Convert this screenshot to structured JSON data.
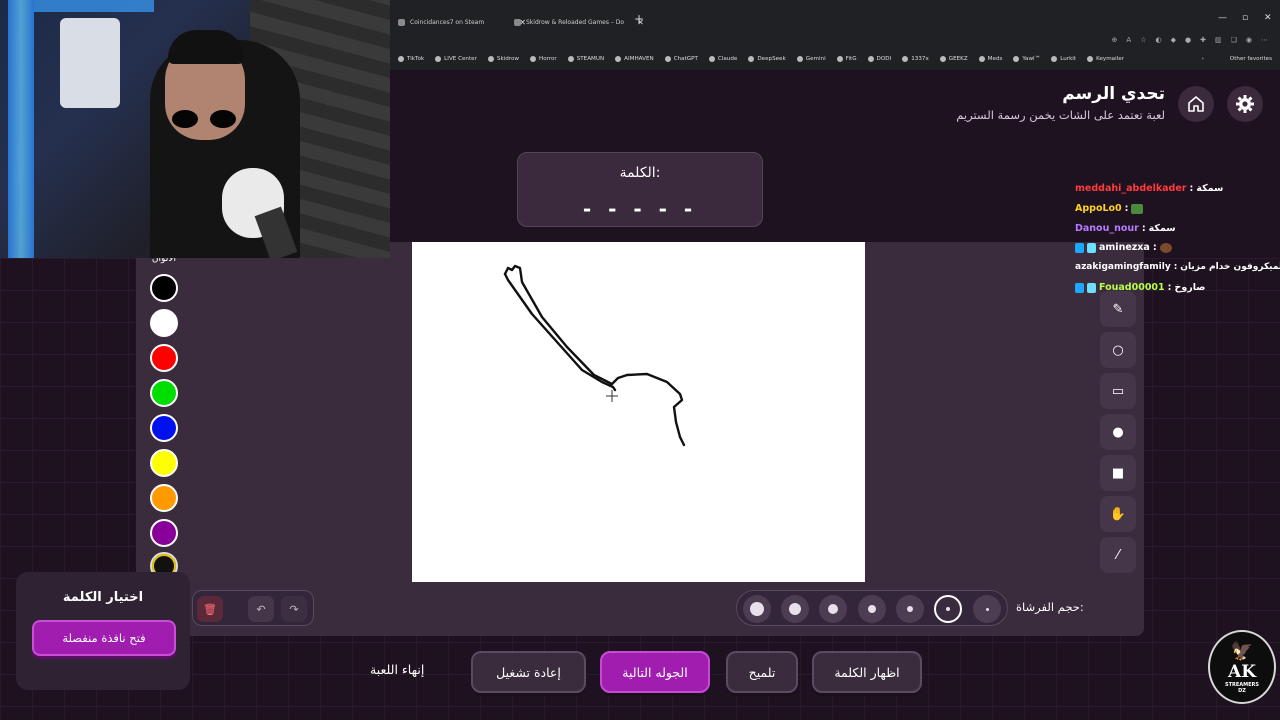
{
  "browser": {
    "tabs": [
      {
        "label": "Coincidances7 on Steam"
      },
      {
        "label": "Skidrow & Reloaded Games – Do"
      }
    ],
    "bookmarks": [
      "TikTok",
      "LIVE Center",
      "Skidrow",
      "Horror",
      "STEAMUN",
      "AIMHAVEN",
      "ChatGPT",
      "Claude",
      "DeepSeek",
      "Gemini",
      "FitG",
      "DODI",
      "1337x",
      "GEEKZ",
      "Meds",
      "Yawl™",
      "Lurkit",
      "Keymailer"
    ],
    "other_favorites": "Other favorites"
  },
  "header": {
    "title": "تحدي الرسم",
    "subtitle": "لعبة تعتمد على الشات يخمن رسمة الستريم"
  },
  "word": {
    "label": "الكلمة:",
    "blanks": "- - - - -"
  },
  "colors": {
    "title": "الألوان",
    "swatches": [
      "#000000",
      "#ffffff",
      "#ff0000",
      "#00dd00",
      "#0011ee",
      "#ffff00",
      "#ff9900",
      "#880099",
      "#111111"
    ]
  },
  "tools": [
    "eraser-icon",
    "circle-outline-icon",
    "rect-outline-icon",
    "circle-fill-icon",
    "rect-fill-icon",
    "fill-icon",
    "line-icon"
  ],
  "brush": {
    "label": "حجم الفرشاة:",
    "selected_index": 5
  },
  "chat": [
    {
      "user": "meddahi_abdelkader",
      "sep": " : ",
      "msg": "سمكة",
      "color": "#ff3b3b"
    },
    {
      "user": "AppoLo0",
      "sep": " : ",
      "msg": "",
      "color": "#ffd21f"
    },
    {
      "user": "Danou_nour",
      "sep": " : ",
      "msg": "سمكة",
      "color": "#b57cff"
    },
    {
      "user": "aminezxa",
      "sep": " : ",
      "msg": "",
      "color": "#ffffff"
    },
    {
      "user": "azakigamingfamily",
      "sep": " : ",
      "msg": "الميكروفون خدام مزيان",
      "color": "#ffffff"
    },
    {
      "user": "Fouad00001",
      "sep": " : ",
      "msg": "صاروخ",
      "color": "#b6ff4a"
    }
  ],
  "pick": {
    "title": "اختيار الكلمة",
    "button": "فتح نافذة منفصلة"
  },
  "buttons": {
    "show_word": "اظهار الكلمة",
    "hint": "تلميح",
    "next_round": "الجوله التالية",
    "restart": "إعادة تشغيل",
    "end_game": "إنهاء اللعبة"
  },
  "logo": {
    "text": "AK",
    "sub": "STREAMERS",
    "sub2": "DZ"
  }
}
